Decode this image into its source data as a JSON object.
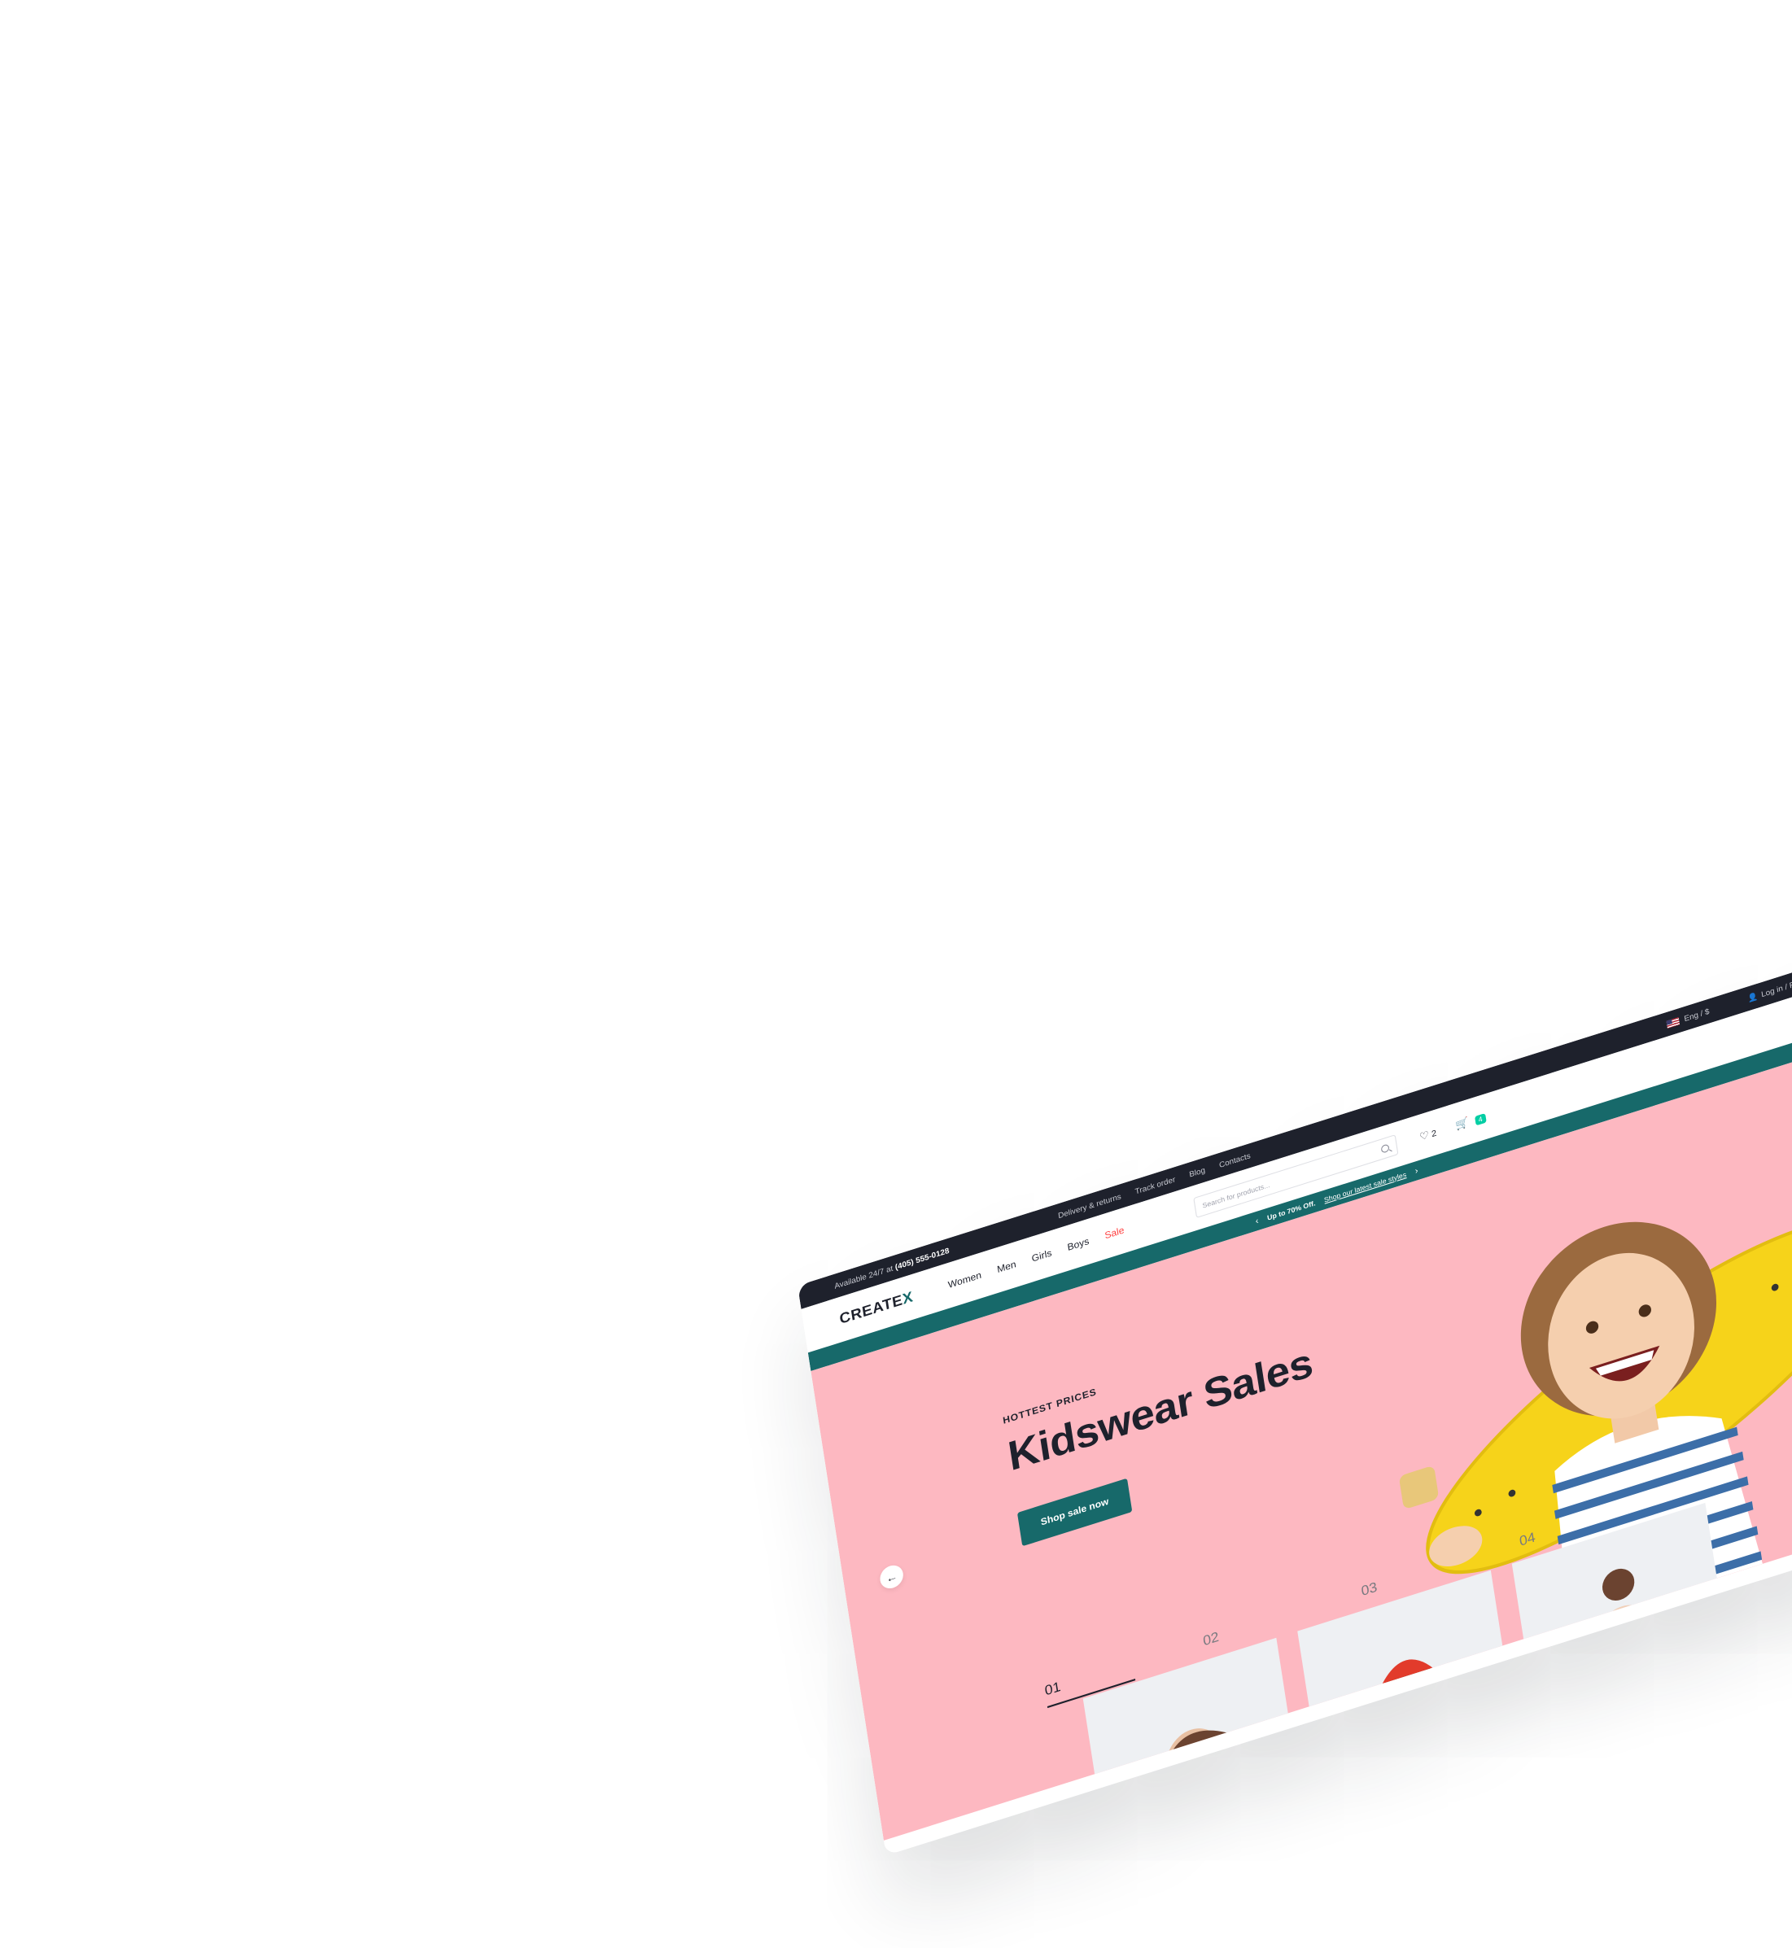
{
  "topbar": {
    "availability_prefix": "Available 24/7 at",
    "phone": "(405) 555-0128",
    "links": [
      "Delivery & returns",
      "Track order",
      "Blog",
      "Contacts"
    ],
    "language": "Eng / $",
    "login": "Log in / Register"
  },
  "header": {
    "logo_main": "CREATE",
    "logo_accent": "X",
    "nav": [
      "Women",
      "Men",
      "Girls",
      "Boys",
      "Sale"
    ],
    "search_placeholder": "Search for products...",
    "wishlist_count": "2",
    "cart_count": "4"
  },
  "promo": {
    "bold": "Up to 70% Off.",
    "link": "Shop our latest sale styles"
  },
  "hero": {
    "eyebrow": "HOTTEST PRICES",
    "title": "Kidswear Sales",
    "cta": "Shop sale now",
    "steps": [
      "01",
      "02",
      "03",
      "04"
    ]
  },
  "colors": {
    "dark": "#1e212c",
    "primary": "#17696a",
    "hero_bg": "#fdb8c1",
    "sale": "#ff4242",
    "badge": "#03cea4",
    "skateboard": "#f6d31a"
  },
  "icons": [
    "heart-icon",
    "cart-icon",
    "search-icon",
    "user-icon",
    "flag-icon",
    "arrow-left-icon",
    "arrow-right-icon",
    "chevron-left-icon",
    "chevron-right-icon"
  ]
}
